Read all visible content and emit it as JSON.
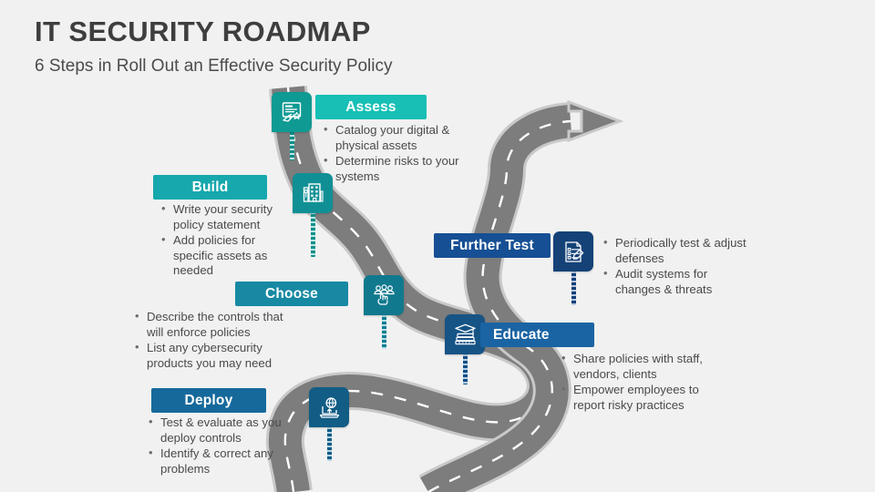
{
  "header": {
    "title": "IT SECURITY ROADMAP",
    "subtitle": "6 Steps in Roll Out an Effective Security Policy"
  },
  "theme": {
    "background": "#f1f1f1",
    "title_color": "#3e3e3e",
    "subtitle_color": "#4b4b4b",
    "bullet_text_color": "#4a4a4a",
    "road_fill": "#7d7d7d",
    "road_edge": "#c9c9c9",
    "road_dash": "#ffffff",
    "banner_text_color": "#ffffff"
  },
  "steps": [
    {
      "id": "assess",
      "label": "Assess",
      "color": "#17bfb4",
      "icon": "checklist-hand-icon",
      "align": "center",
      "bullets": [
        "Catalog your digital &",
        "physical assets",
        "Determine risks to your",
        "systems"
      ],
      "bullet_items": [
        "Catalog your digital & physical assets",
        "Determine risks to your systems"
      ]
    },
    {
      "id": "build",
      "label": "Build",
      "color": "#16a8ad",
      "icon": "building-icon",
      "align": "center",
      "bullet_items": [
        "Write your security policy statement",
        "Add policies for specific assets as needed"
      ]
    },
    {
      "id": "choose",
      "label": "Choose",
      "color": "#1789a3",
      "icon": "people-select-icon",
      "align": "center",
      "bullet_items": [
        "Describe the controls that will enforce policies",
        "List any cybersecurity products you may need"
      ]
    },
    {
      "id": "deploy",
      "label": "Deploy",
      "color": "#16699b",
      "icon": "laptop-globe-upload-icon",
      "align": "center",
      "bullet_items": [
        "Test & evaluate as you deploy controls",
        "Identify & correct any problems"
      ]
    },
    {
      "id": "educate",
      "label": "Educate",
      "color": "#1a64a3",
      "icon": "graduation-books-icon",
      "align": "left",
      "bullet_items": [
        "Share policies with staff, vendors, clients",
        "Empower employees to report risky practices"
      ]
    },
    {
      "id": "further-test",
      "label": "Further Test",
      "color": "#164f94",
      "icon": "clipboard-pencil-icon",
      "align": "center",
      "bullet_items": [
        "Periodically test & adjust defenses",
        "Audit systems for changes & threats"
      ]
    }
  ]
}
